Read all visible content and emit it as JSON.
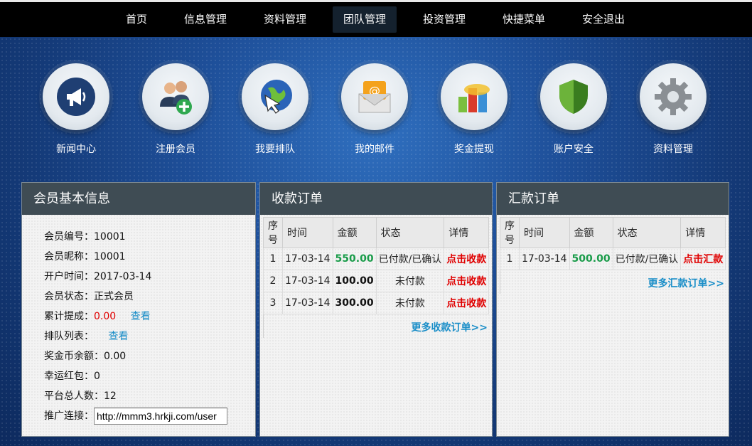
{
  "nav": [
    "首页",
    "信息管理",
    "资料管理",
    "团队管理",
    "投资管理",
    "快捷菜单",
    "安全退出"
  ],
  "nav_active": "团队管理",
  "shortcuts": [
    {
      "label": "新闻中心",
      "icon": "megaphone-icon"
    },
    {
      "label": "注册会员",
      "icon": "add-member-icon"
    },
    {
      "label": "我要排队",
      "icon": "globe-cursor-icon"
    },
    {
      "label": "我的邮件",
      "icon": "mail-icon"
    },
    {
      "label": "奖金提现",
      "icon": "pie-chart-icon"
    },
    {
      "label": "账户安全",
      "icon": "shield-icon"
    },
    {
      "label": "资料管理",
      "icon": "gear-icon"
    }
  ],
  "member": {
    "title": "会员基本信息",
    "id": "会员编号：10001",
    "nickname": "会员昵称：10001",
    "open_time": "开户时间：2017-03-14",
    "status": "会员状态：正式会员",
    "commission_label": "累计提成：",
    "commission_value": "0.00",
    "view": "查看",
    "queue_label": "排队列表：",
    "bonus_balance": "奖金币余额：0.00",
    "lucky": "幸运红包：0",
    "platform_total": "平台总人数：12",
    "promo_label": "推广连接：",
    "promo_value": "http://mmm3.hrkji.com/user"
  },
  "receive": {
    "title": "收款订单",
    "headers": [
      "序号",
      "时间",
      "金额",
      "状态",
      "详情"
    ],
    "rows": [
      {
        "idx": "1",
        "time": "17-03-14",
        "amount": "550.00",
        "status": "已付款/已确认",
        "action": "点击收款"
      },
      {
        "idx": "2",
        "time": "17-03-14",
        "amount": "100.00",
        "status": "未付款",
        "action": "点击收款"
      },
      {
        "idx": "3",
        "time": "17-03-14",
        "amount": "300.00",
        "status": "未付款",
        "action": "点击收款"
      }
    ],
    "more": "更多收款订单>>"
  },
  "remit": {
    "title": "汇款订单",
    "headers": [
      "序号",
      "时间",
      "金额",
      "状态",
      "详情"
    ],
    "rows": [
      {
        "idx": "1",
        "time": "17-03-14",
        "amount": "500.00",
        "status": "已付款/已确认",
        "action": "点击汇款"
      }
    ],
    "more": "更多汇款订单>>"
  }
}
